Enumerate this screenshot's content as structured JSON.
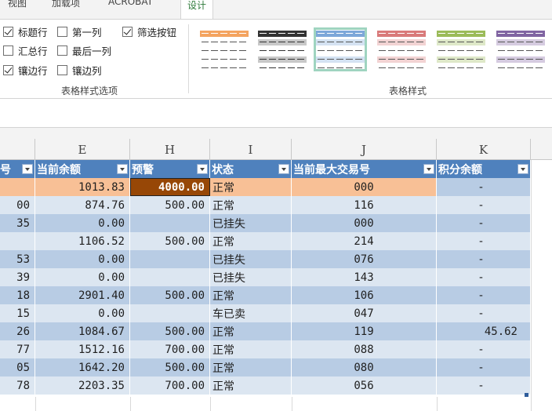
{
  "ribbon": {
    "tabs": [
      "视图",
      "加载项",
      "ACROBAT",
      "设计"
    ],
    "options": [
      {
        "label": "标题行",
        "checked": true
      },
      {
        "label": "第一列",
        "checked": false
      },
      {
        "label": "筛选按钮",
        "checked": true
      },
      {
        "label": "汇总行",
        "checked": false
      },
      {
        "label": "最后一列",
        "checked": false
      },
      {
        "label": "镶边行",
        "checked": true
      },
      {
        "label": "镶边列",
        "checked": false
      }
    ],
    "group_options_label": "表格样式选项",
    "group_styles_label": "表格样式",
    "style_colors": [
      "#f4a460",
      "#333333",
      "#7da7d9",
      "#d97a7a",
      "#9bbb59",
      "#8064a2"
    ]
  },
  "columns": [
    "E",
    "H",
    "I",
    "J",
    "K"
  ],
  "header": {
    "partial": "号",
    "E": "当前余额",
    "H": "预警",
    "I": "状态",
    "J": "当前最大交易号",
    "K": "积分余额"
  },
  "rows": [
    {
      "a": "",
      "e": "1013.83",
      "h": "4000.00",
      "i": "正常",
      "j": "000",
      "k": "-"
    },
    {
      "a": "00",
      "e": "874.76",
      "h": "500.00",
      "i": "正常",
      "j": "116",
      "k": "-"
    },
    {
      "a": "35",
      "e": "0.00",
      "h": "",
      "i": "已挂失",
      "j": "000",
      "k": "-"
    },
    {
      "a": "",
      "e": "1106.52",
      "h": "500.00",
      "i": "正常",
      "j": "214",
      "k": "-"
    },
    {
      "a": "53",
      "e": "0.00",
      "h": "",
      "i": "已挂失",
      "j": "076",
      "k": "-"
    },
    {
      "a": "39",
      "e": "0.00",
      "h": "",
      "i": "已挂失",
      "j": "143",
      "k": "-"
    },
    {
      "a": "18",
      "e": "2901.40",
      "h": "500.00",
      "i": "正常",
      "j": "106",
      "k": "-"
    },
    {
      "a": "15",
      "e": "0.00",
      "h": "",
      "i": "车已卖",
      "j": "047",
      "k": "-"
    },
    {
      "a": "26",
      "e": "1084.67",
      "h": "500.00",
      "i": "正常",
      "j": "119",
      "k": "45.62"
    },
    {
      "a": "77",
      "e": "1512.16",
      "h": "700.00",
      "i": "正常",
      "j": "088",
      "k": "-"
    },
    {
      "a": "05",
      "e": "1642.20",
      "h": "500.00",
      "i": "正常",
      "j": "080",
      "k": "-"
    },
    {
      "a": "78",
      "e": "2203.35",
      "h": "700.00",
      "i": "正常",
      "j": "056",
      "k": "-"
    }
  ],
  "colors": {
    "header_blue": "#4f81bd",
    "band_dark": "#b8cce4",
    "band_light": "#dce6f1",
    "highlight_row": "#f8c096",
    "highlight_cell": "#974706"
  }
}
